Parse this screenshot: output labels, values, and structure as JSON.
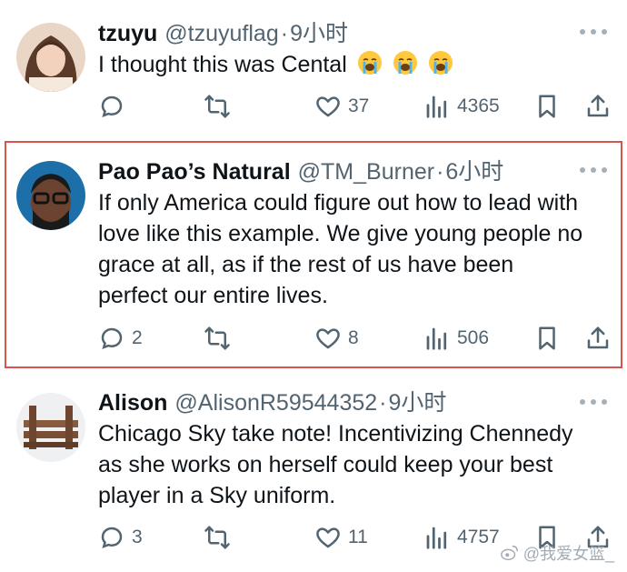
{
  "tweets": [
    {
      "name": "tzuyu",
      "handle": "@tzuyuflag",
      "separator": "·",
      "time": "9小时",
      "text": "I thought this was Cental",
      "emoji": [
        "loudly-crying-face",
        "loudly-crying-face",
        "loudly-crying-face"
      ],
      "stats": {
        "replies": "",
        "retweets": "",
        "likes": "37",
        "views": "4365"
      }
    },
    {
      "name": "Pao Pao’s Natural",
      "handle": "@TM_Burner",
      "separator": "·",
      "time": "6小时",
      "text_lines": [
        "If only America could figure out how to lead with",
        "love like this example. We give young people no",
        "grace at all, as if the rest of us have been",
        "perfect our entire lives."
      ],
      "highlighted": true,
      "highlight_color": "#d9534f",
      "stats": {
        "replies": "2",
        "retweets": "",
        "likes": "8",
        "views": "506"
      }
    },
    {
      "name": "Alison",
      "handle": "@AlisonR59544352",
      "separator": "·",
      "time": "9小时",
      "text_lines": [
        "Chicago Sky take note! Incentivizing Chennedy",
        "as she works on herself could keep your best",
        "player in a Sky uniform."
      ],
      "stats": {
        "replies": "3",
        "retweets": "",
        "likes": "11",
        "views": "4757"
      }
    }
  ],
  "watermark": {
    "text": "@我爱女篮_",
    "icon": "weibo-icon"
  },
  "colors": {
    "text": "#0f1419",
    "secondary": "#536471",
    "highlight_border": "#d9534f"
  },
  "icons": [
    "reply-icon",
    "retweet-icon",
    "like-icon",
    "views-icon",
    "bookmark-icon",
    "share-icon",
    "more-icon"
  ]
}
